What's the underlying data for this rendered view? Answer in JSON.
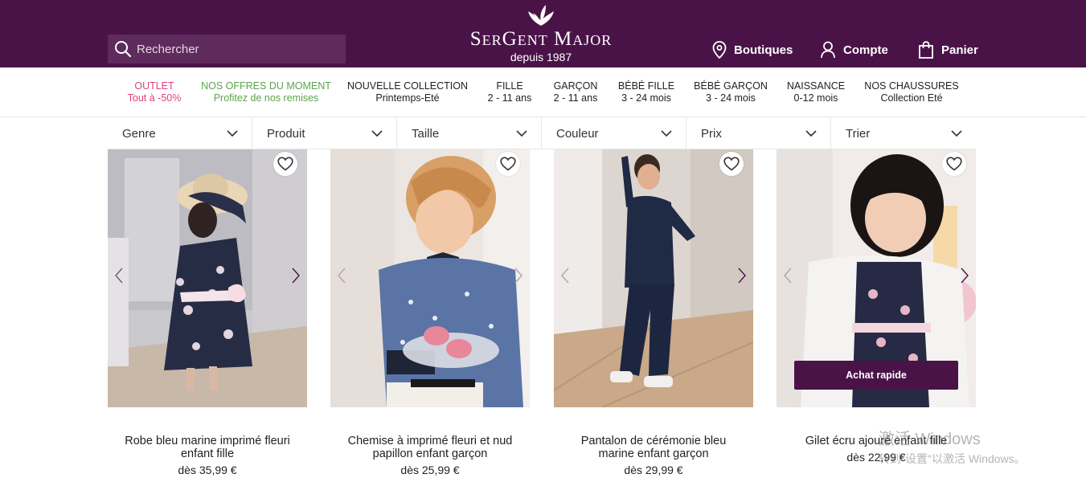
{
  "header": {
    "search_placeholder": "Rechercher",
    "brand": "SerGent Major",
    "since": "depuis 1987",
    "nav": {
      "stores": "Boutiques",
      "account": "Compte",
      "cart": "Panier"
    },
    "bg_color": "#4a1348"
  },
  "categories": [
    {
      "line1": "OUTLET",
      "line2": "Tout à -50%",
      "color": "#e0407e"
    },
    {
      "line1": "NOS OFFRES DU MOMENT",
      "line2": "Profitez de nos remises",
      "color": "#5aa54a"
    },
    {
      "line1": "NOUVELLE COLLECTION",
      "line2": "Printemps-Eté",
      "color": "#222222"
    },
    {
      "line1": "FILLE",
      "line2": "2 - 11 ans",
      "color": "#222222"
    },
    {
      "line1": "GARÇON",
      "line2": "2 - 11 ans",
      "color": "#222222"
    },
    {
      "line1": "BÉBÉ FILLE",
      "line2": "3 - 24 mois",
      "color": "#222222"
    },
    {
      "line1": "BÉBÉ GARÇON",
      "line2": "3 - 24 mois",
      "color": "#222222"
    },
    {
      "line1": "NAISSANCE",
      "line2": "0-12 mois",
      "color": "#222222"
    },
    {
      "line1": "NOS CHAUSSURES",
      "line2": "Collection Eté",
      "color": "#222222"
    }
  ],
  "filters": [
    "Genre",
    "Produit",
    "Taille",
    "Couleur",
    "Prix",
    "Trier"
  ],
  "products": [
    {
      "name": "Robe bleu marine imprimé fleuri enfant fille",
      "price": "dès  35,99 €"
    },
    {
      "name": "Chemise à imprimé fleuri et nud papillon enfant garçon",
      "price": "dès  25,99 €"
    },
    {
      "name": "Pantalon de cérémonie bleu marine enfant garçon",
      "price": "dès  29,99 €"
    },
    {
      "name": "Gilet écru ajouré enfant fille",
      "price": "dès  22,99 €"
    }
  ],
  "quick_buy_label": "Achat rapide",
  "watermark": {
    "line1": "激活 Windows",
    "line2": "转到\"设置\"以激活 Windows。"
  }
}
